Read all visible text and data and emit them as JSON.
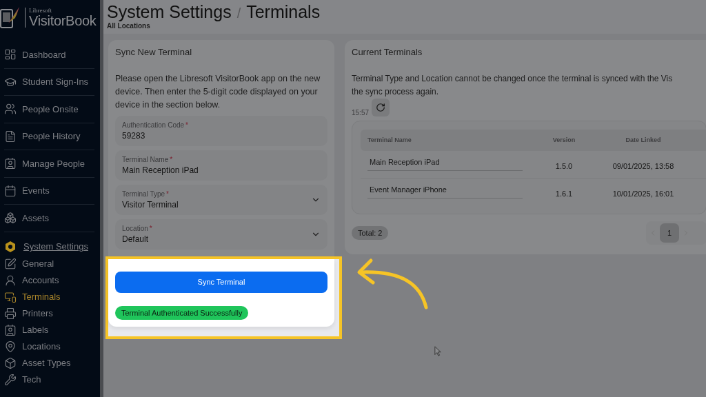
{
  "brand": {
    "small": "Libresoft",
    "name": "VisitorBook"
  },
  "sidebar": {
    "items": [
      {
        "label": "Dashboard",
        "kind": "main",
        "selected": false
      },
      {
        "label": "Student Sign-Ins",
        "kind": "main",
        "selected": false
      },
      {
        "label": "People Onsite",
        "kind": "main",
        "selected": false
      },
      {
        "label": "People History",
        "kind": "main",
        "selected": false
      },
      {
        "label": "Manage People",
        "kind": "main",
        "selected": false
      },
      {
        "label": "Events",
        "kind": "main",
        "selected": false
      },
      {
        "label": "Assets",
        "kind": "main",
        "selected": false
      },
      {
        "label": "System Settings",
        "kind": "section",
        "selected": false
      },
      {
        "label": "General",
        "kind": "sub",
        "selected": false
      },
      {
        "label": "Accounts",
        "kind": "sub",
        "selected": false
      },
      {
        "label": "Terminals",
        "kind": "sub",
        "selected": true
      },
      {
        "label": "Printers",
        "kind": "sub",
        "selected": false
      },
      {
        "label": "Labels",
        "kind": "sub",
        "selected": false
      },
      {
        "label": "Locations",
        "kind": "sub",
        "selected": false
      },
      {
        "label": "Asset Types",
        "kind": "sub",
        "selected": false
      },
      {
        "label": "Tech",
        "kind": "sub",
        "selected": false
      }
    ]
  },
  "header": {
    "title": "System Settings",
    "separator": "/",
    "current": "Terminals",
    "subtitle": "All Locations"
  },
  "sync_card": {
    "title": "Sync New Terminal",
    "instructions": "Please open the Libresoft VisitorBook app on the new device. Then enter the 5-digit code displayed on your device in the section below.",
    "fields": [
      {
        "label": "Authentication Code",
        "required_mark": "*",
        "value": "59283",
        "kind": "text"
      },
      {
        "label": "Terminal Name",
        "required_mark": "*",
        "value": "Main Reception iPad",
        "kind": "text"
      },
      {
        "label": "Terminal Type",
        "required_mark": "*",
        "value": "Visitor Terminal",
        "kind": "select"
      },
      {
        "label": "Location",
        "required_mark": "*",
        "value": "Default",
        "kind": "select"
      }
    ],
    "button": "Sync Terminal",
    "status": "Terminal Authenticated Successfully"
  },
  "terminals_card": {
    "title": "Current Terminals",
    "note_lines": [
      "Terminal Type and Location cannot be changed once the terminal is synced with the Vis",
      "the sync process again."
    ],
    "refreshed": "15:57",
    "table": {
      "columns": [
        "Terminal Name",
        "Version",
        "Date Linked"
      ],
      "rows": [
        [
          "Main Reception iPad",
          "1.5.0",
          "09/01/2025, 13:58"
        ],
        [
          "Event Manager iPhone",
          "1.6.1",
          "10/01/2025, 16:01"
        ]
      ]
    },
    "total": "Total: 2",
    "pages": [
      {
        "label": "1",
        "selected": true
      }
    ]
  }
}
